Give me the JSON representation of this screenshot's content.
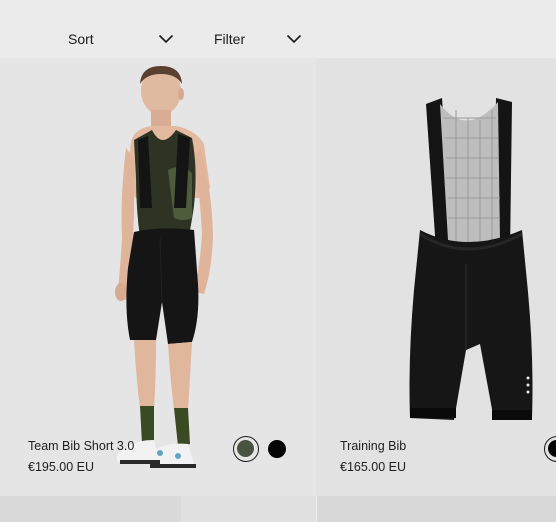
{
  "toolbar": {
    "sort_label": "Sort",
    "sort_icon": "chevron-down-icon",
    "filter_label": "Filter",
    "filter_icon": "chevron-down-icon"
  },
  "products": [
    {
      "name": "Team Bib Short 3.0",
      "price": "€195.00 EU",
      "image": "model-wearing-bib-short-image",
      "swatches": [
        {
          "color": "#4a5240",
          "selected": true
        },
        {
          "color": "#050505",
          "selected": false
        }
      ]
    },
    {
      "name": "Training Bib",
      "price": "€165.00 EU",
      "image": "training-bib-product-image",
      "swatches": [
        {
          "color": "#050505",
          "selected": true
        }
      ]
    }
  ],
  "colors": {
    "background": "#ebebeb",
    "card_1_bg": "#e5e5e5",
    "card_2_bg": "#e2e2e2",
    "text": "#1e1e1e"
  }
}
